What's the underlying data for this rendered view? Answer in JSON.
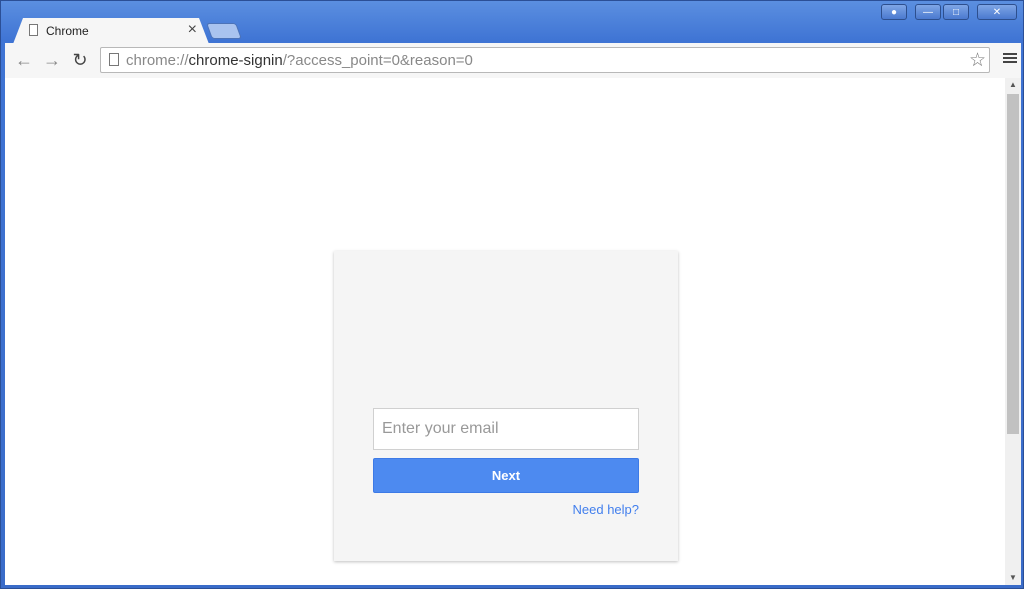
{
  "window": {
    "caption_icons": [
      "user-icon",
      "minimize-icon",
      "maximize-icon",
      "close-icon"
    ]
  },
  "tabs": [
    {
      "label": "Chrome",
      "active": true
    }
  ],
  "toolbar": {
    "url_prefix": "chrome://",
    "url_host": "chrome-signin",
    "url_rest": "/?access_point=0&reason=0"
  },
  "signin": {
    "email_placeholder": "Enter your email",
    "email_value": "",
    "next_label": "Next",
    "help_link": "Need help?"
  },
  "colors": {
    "accent": "#4d8af0",
    "link": "#427fed",
    "window_frame": "#3f74d4"
  }
}
